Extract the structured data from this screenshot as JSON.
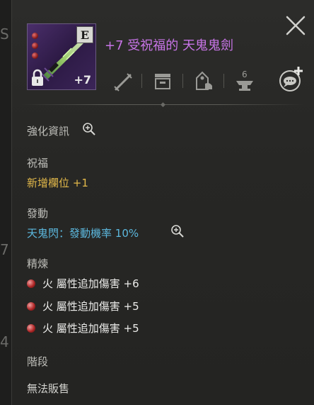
{
  "item": {
    "name": "+7 受祝福的 天鬼鬼劍",
    "grade": "E",
    "enhance_level": "+7",
    "socket_count": 3,
    "locked": true
  },
  "actions": [
    {
      "name": "weapon-icon"
    },
    {
      "name": "storage-icon"
    },
    {
      "name": "shop-bag-icon"
    },
    {
      "name": "anvil-icon"
    },
    {
      "name": "chat-add-icon"
    }
  ],
  "sections": {
    "enhance_info": {
      "label": "強化資訊"
    },
    "blessing": {
      "label": "祝福",
      "value": "新增欄位 +1"
    },
    "activation": {
      "label": "發動",
      "skill": "天鬼閃",
      "sep": "：",
      "detail": "發動機率 10%"
    },
    "refine": {
      "label": "精煉",
      "items": [
        {
          "text": "火 屬性追加傷害 +6"
        },
        {
          "text": "火 屬性追加傷害 +5"
        },
        {
          "text": "火 屬性追加傷害 +5"
        }
      ]
    },
    "tier": {
      "label": "階段",
      "value": "無法販售"
    }
  },
  "left_edge_fragments": [
    "S",
    "7",
    "4"
  ],
  "colors": {
    "title": "#c774e6",
    "yellow": "#e2b84a",
    "blue": "#5cb8de"
  }
}
